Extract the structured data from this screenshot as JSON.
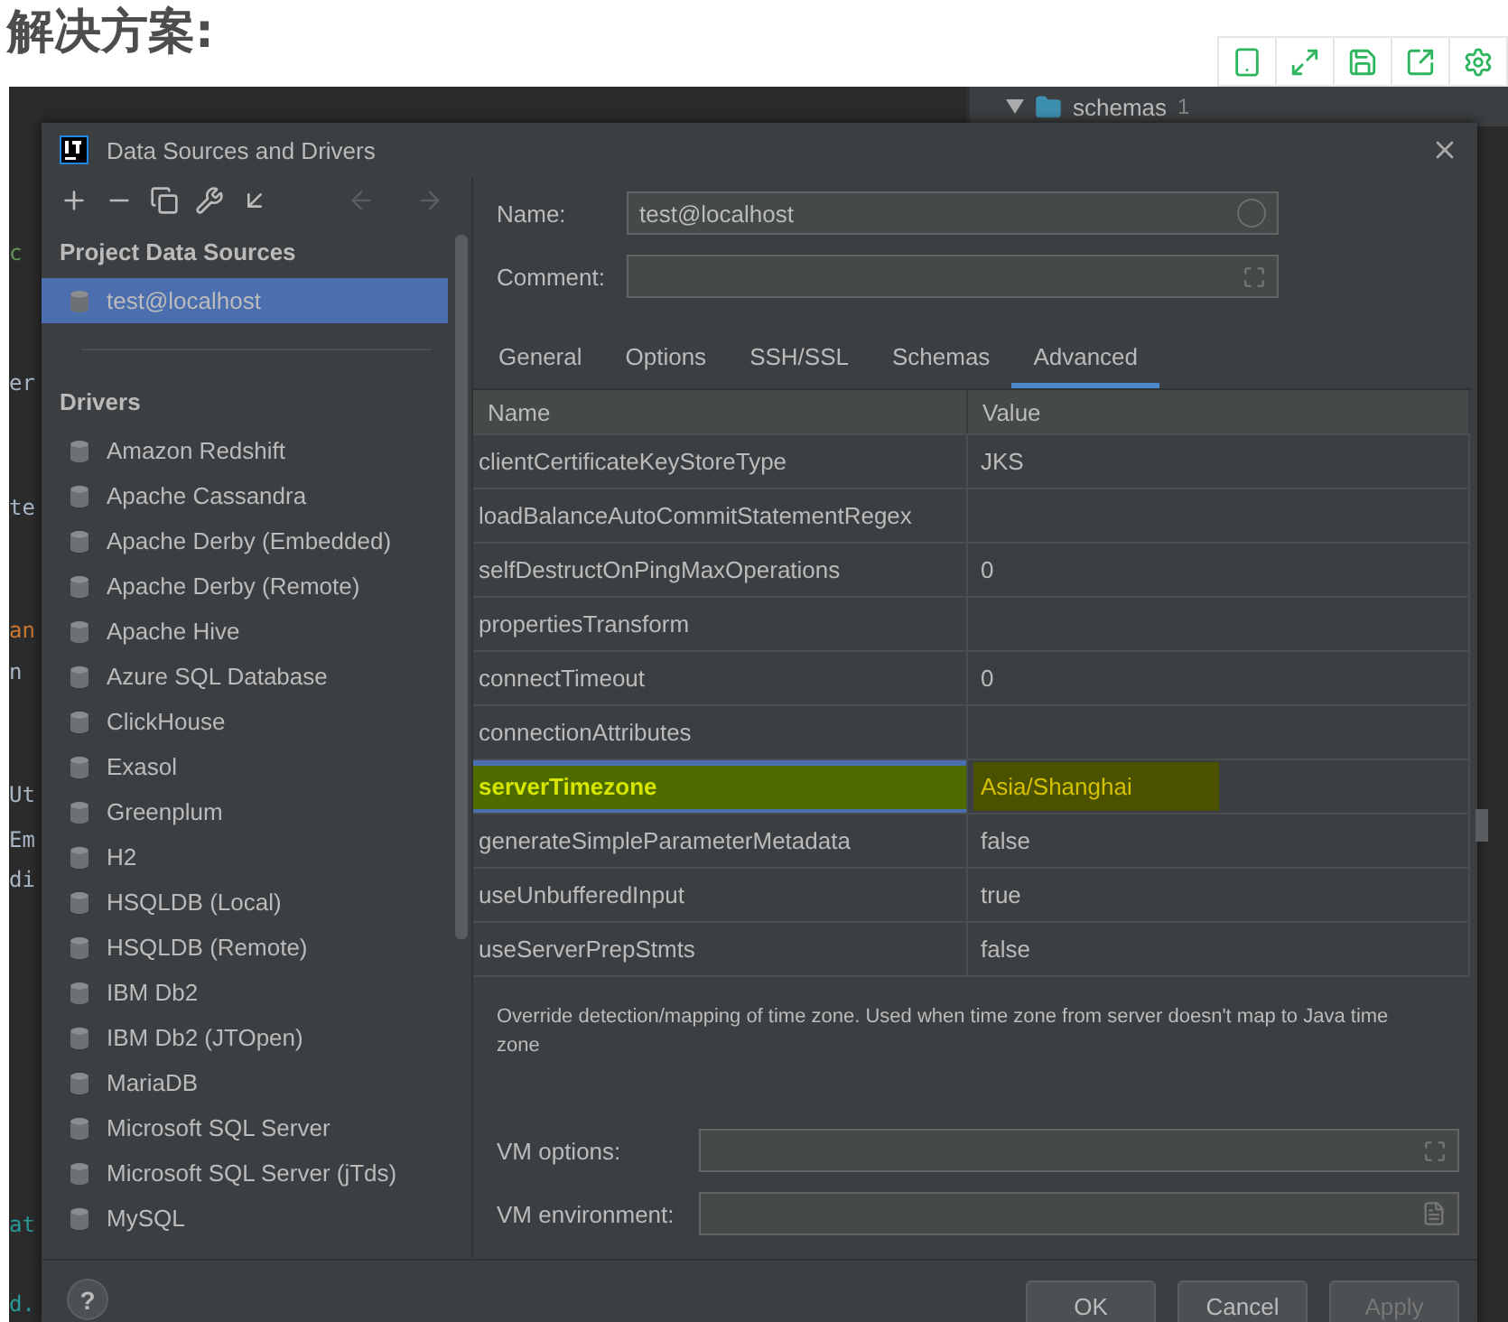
{
  "heading": "解决方案:",
  "ide": {
    "tree_item": {
      "label": "schemas",
      "count": "1",
      "expanded": true
    },
    "code_fragments": [
      {
        "text": "c",
        "color": "#629755"
      },
      {
        "text": "er",
        "color": "#a9b7c6"
      },
      {
        "text": "te",
        "color": "#a9b7c6"
      },
      {
        "text": "an",
        "color": "#cc7832"
      },
      {
        "text": "n",
        "color": "#a9b7c6"
      },
      {
        "text": "Ut",
        "color": "#a9b7c6"
      },
      {
        "text": "Em",
        "color": "#a9b7c6"
      },
      {
        "text": "di",
        "color": "#a9b7c6"
      },
      {
        "text": "at",
        "color": "#299999"
      },
      {
        "text": "d.",
        "color": "#299999"
      }
    ]
  },
  "dialog": {
    "title": "Data Sources and Drivers",
    "sidebar": [
      {
        "title": "Project Data Sources",
        "items": [
          {
            "label": "test@localhost",
            "selected": true
          }
        ]
      },
      {
        "title": "Drivers",
        "items": [
          {
            "label": "Amazon Redshift",
            "selected": false
          },
          {
            "label": "Apache Cassandra",
            "selected": false
          },
          {
            "label": "Apache Derby (Embedded)",
            "selected": false
          },
          {
            "label": "Apache Derby (Remote)",
            "selected": false
          },
          {
            "label": "Apache Hive",
            "selected": false
          },
          {
            "label": "Azure SQL Database",
            "selected": false
          },
          {
            "label": "ClickHouse",
            "selected": false
          },
          {
            "label": "Exasol",
            "selected": false
          },
          {
            "label": "Greenplum",
            "selected": false
          },
          {
            "label": "H2",
            "selected": false
          },
          {
            "label": "HSQLDB (Local)",
            "selected": false
          },
          {
            "label": "HSQLDB (Remote)",
            "selected": false
          },
          {
            "label": "IBM Db2",
            "selected": false
          },
          {
            "label": "IBM Db2 (JTOpen)",
            "selected": false
          },
          {
            "label": "MariaDB",
            "selected": false
          },
          {
            "label": "Microsoft SQL Server",
            "selected": false
          },
          {
            "label": "Microsoft SQL Server (jTds)",
            "selected": false
          },
          {
            "label": "MySQL",
            "selected": false
          }
        ]
      }
    ],
    "name_label": "Name:",
    "name_value": "test@localhost",
    "comment_label": "Comment:",
    "tabs": [
      {
        "label": "General",
        "selected": false
      },
      {
        "label": "Options",
        "selected": false
      },
      {
        "label": "SSH/SSL",
        "selected": false
      },
      {
        "label": "Schemas",
        "selected": false
      },
      {
        "label": "Advanced",
        "selected": true
      }
    ],
    "table": {
      "columns": [
        "Name",
        "Value"
      ],
      "rows": [
        {
          "name": "clientCertificateKeyStoreType",
          "value": "JKS",
          "selected": false
        },
        {
          "name": "loadBalanceAutoCommitStatementRegex",
          "selected": false
        },
        {
          "name": "selfDestructOnPingMaxOperations",
          "value": "0",
          "selected": false
        },
        {
          "name": "propertiesTransform",
          "selected": false
        },
        {
          "name": "connectTimeout",
          "value": "0",
          "selected": false
        },
        {
          "name": "connectionAttributes",
          "selected": false
        },
        {
          "name": "serverTimezone",
          "value": "Asia/Shanghai",
          "selected": true
        },
        {
          "name": "generateSimpleParameterMetadata",
          "value": "false",
          "selected": false
        },
        {
          "name": "useUnbufferedInput",
          "value": "true",
          "selected": false
        },
        {
          "name": "useServerPrepStmts",
          "value": "false",
          "selected": false
        }
      ]
    },
    "description": "Override detection/mapping of time zone. Used when time zone from server doesn't map to Java time zone",
    "vm_options_label": "VM options:",
    "vm_environment_label": "VM environment:",
    "help": "?",
    "buttons": [
      {
        "label": "OK",
        "disabled": false
      },
      {
        "label": "Cancel",
        "disabled": false
      },
      {
        "label": "Apply",
        "disabled": true
      }
    ]
  }
}
